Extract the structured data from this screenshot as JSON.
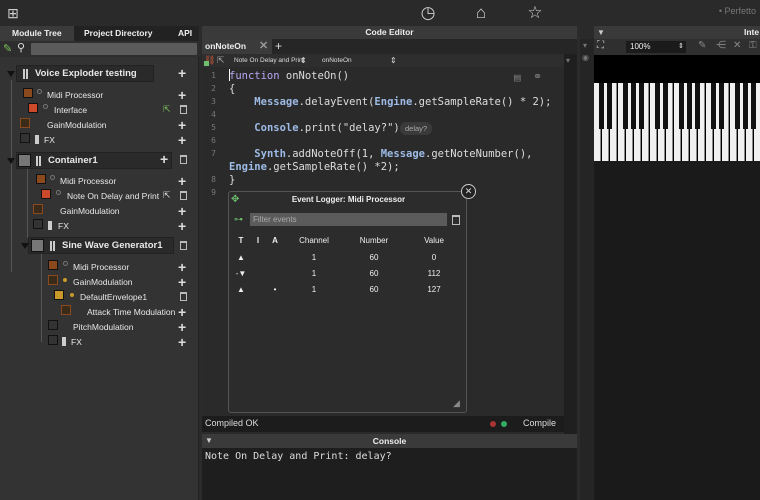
{
  "topbar": {
    "perfetto": "• Perfetto"
  },
  "left_panel": {
    "tabs": [
      "Module Tree",
      "Project Directory",
      "API"
    ],
    "tree": [
      {
        "label": "Voice Exploder testing",
        "color": "#1a1a1a"
      },
      {
        "label": "Midi Processor",
        "color": "#8a4a1e"
      },
      {
        "label": "Interface",
        "color": "#cc4a2a"
      },
      {
        "label": "GainModulation",
        "color": "#8a4a1e"
      },
      {
        "label": "FX",
        "color": "#333333"
      },
      {
        "label": "Container1",
        "color": "#777777"
      },
      {
        "label": "Midi Processor",
        "color": "#8a4a1e"
      },
      {
        "label": "Note On Delay and Print",
        "color": "#cc4a2a"
      },
      {
        "label": "GainModulation",
        "color": "#8a4a1e"
      },
      {
        "label": "FX",
        "color": "#333333"
      },
      {
        "label": "Sine Wave Generator1",
        "color": "#777777"
      },
      {
        "label": "Midi Processor",
        "color": "#8a4a1e"
      },
      {
        "label": "GainModulation",
        "color": "#8a4a1e"
      },
      {
        "label": "DefaultEnvelope1",
        "color": "#c99a2a"
      },
      {
        "label": "Attack Time Modulation",
        "color": "#8a4a1e"
      },
      {
        "label": "PitchModulation",
        "color": "#333333"
      },
      {
        "label": "FX",
        "color": "#333333"
      }
    ]
  },
  "editor": {
    "title": "Code Editor",
    "tab": "onNoteOn",
    "ctrl_file": "Note On Delay and Print",
    "ctrl_callback": "onNoteOn",
    "lines": [
      {
        "n": "1",
        "html": "<span class=\"kw\">function</span> onNoteOn()"
      },
      {
        "n": "2",
        "html": "{"
      },
      {
        "n": "3",
        "html": "    <span class=\"obj\">Message</span>.delayEvent(<span class=\"obj\">Engine</span>.getSampleRate() * 2);"
      },
      {
        "n": "4",
        "html": ""
      },
      {
        "n": "5",
        "html": "    <span class=\"obj\">Console</span>.print(\"delay?\");"
      },
      {
        "n": "6",
        "html": ""
      },
      {
        "n": "7",
        "html": "    <span class=\"obj\">Synth</span>.addNoteOff(1, <span class=\"obj\">Message</span>.getNoteNumber(),"
      },
      {
        "n": "",
        "html": "<span class=\"obj\">Engine</span>.getSampleRate() *2);"
      },
      {
        "n": "8",
        "html": "}"
      },
      {
        "n": "9",
        "html": ""
      }
    ],
    "inline_badge": "delay?",
    "compile_status": "Compiled OK",
    "compile_button": "Compile"
  },
  "logger": {
    "title": "Event Logger: Midi Processor",
    "filter_placeholder": "Filter events",
    "columns": [
      "T",
      "I",
      "A",
      "Channel",
      "Number",
      "Value"
    ],
    "rows": [
      {
        "t": "▲",
        "i": "",
        "a": "",
        "channel": "1",
        "number": "60",
        "value": "0"
      },
      {
        "t": "-▼",
        "i": "",
        "a": "",
        "channel": "1",
        "number": "60",
        "value": "112"
      },
      {
        "t": "▲",
        "i": "",
        "a": "•",
        "channel": "1",
        "number": "60",
        "value": "127"
      }
    ]
  },
  "console": {
    "title": "Console",
    "output": "Note On Delay and Print: delay?"
  },
  "right_panel": {
    "title": "Inte",
    "zoom": "100%"
  }
}
